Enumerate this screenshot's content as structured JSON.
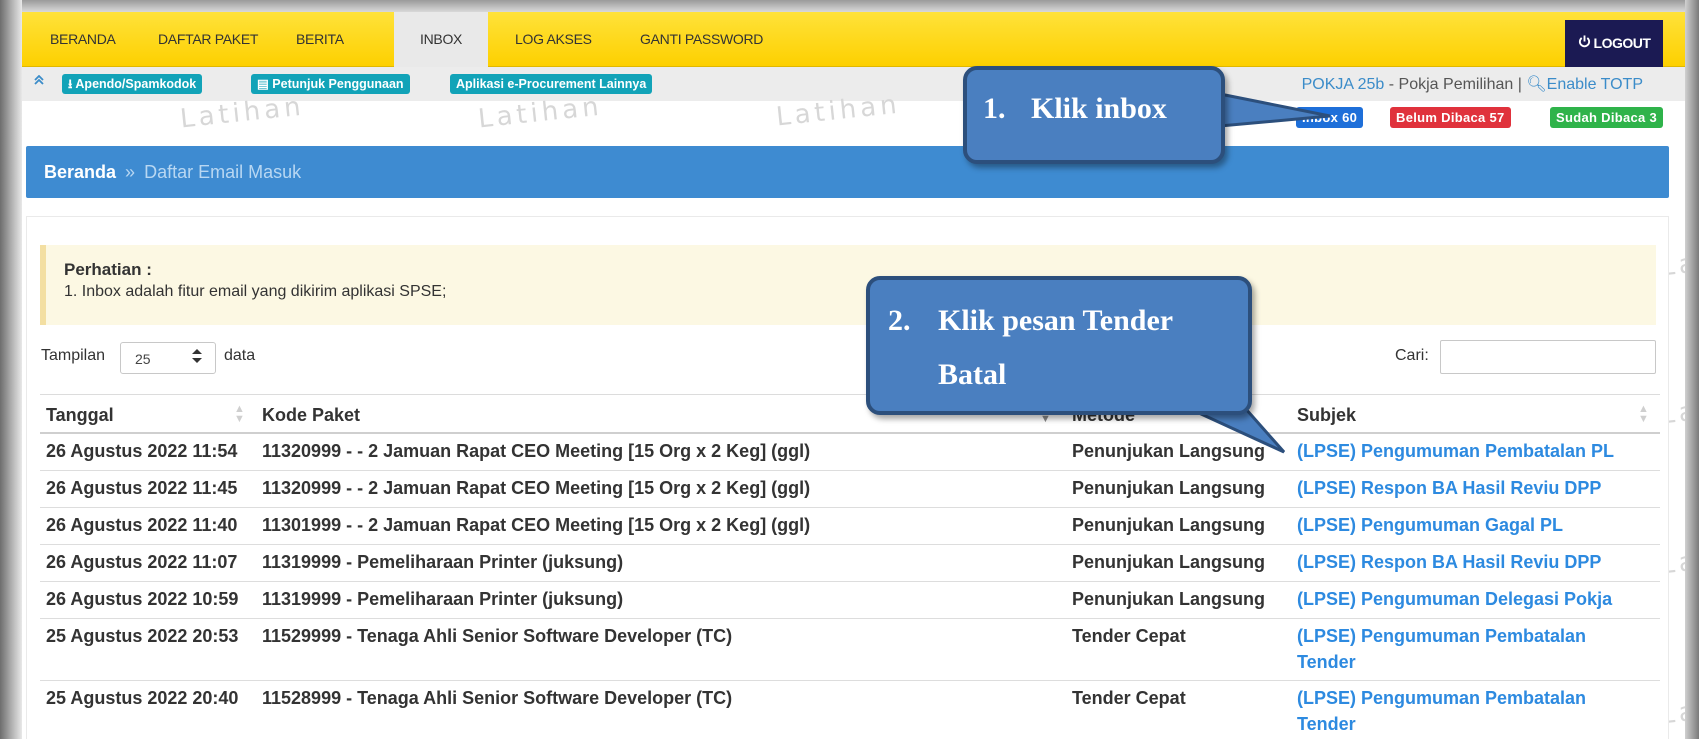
{
  "nav": {
    "items": [
      "BERANDA",
      "DAFTAR PAKET",
      "BERITA",
      "INBOX",
      "LOG AKSES",
      "GANTI PASSWORD"
    ],
    "logout_label": "LOGOUT",
    "active_item": "INBOX"
  },
  "subbar": {
    "links": [
      "Apendo/Spamkodok",
      "Petunjuk Penggunaan",
      "Aplikasi e-Procurement Lainnya"
    ],
    "user_name": "POKJA 25b",
    "user_role": " - Pokja Pemilihan | ",
    "enable_totp": "Enable TOTP"
  },
  "badges": {
    "inbox": "Inbox 60",
    "unread": "Belum Dibaca 57",
    "read": "Sudah Dibaca 3"
  },
  "watermark": "Latihan",
  "breadcrumb": {
    "home": "Beranda",
    "separator": "»",
    "current": "Daftar Email Masuk"
  },
  "notice": {
    "title": "Perhatian :",
    "text": "1. Inbox adalah fitur email yang dikirim aplikasi SPSE;"
  },
  "controls": {
    "show_label": "Tampilan",
    "page_length": "25",
    "data_label": "data",
    "search_label": "Cari:",
    "search_value": ""
  },
  "table": {
    "headers": [
      "Tanggal",
      "Kode Paket",
      "Metode",
      "Subjek"
    ],
    "rows": [
      {
        "date": "26 Agustus 2022 11:54",
        "kode": "11320999 - - 2 Jamuan Rapat CEO Meeting [15 Org x 2 Keg] (ggl)",
        "metode": "Penunjukan Langsung",
        "subjek": "(LPSE) Pengumuman Pembatalan PL"
      },
      {
        "date": "26 Agustus 2022 11:45",
        "kode": "11320999 - - 2 Jamuan Rapat CEO Meeting [15 Org x 2 Keg] (ggl)",
        "metode": "Penunjukan Langsung",
        "subjek": "(LPSE) Respon BA Hasil Reviu DPP"
      },
      {
        "date": "26 Agustus 2022 11:40",
        "kode": "11301999 - - 2 Jamuan Rapat CEO Meeting [15 Org x 2 Keg] (ggl)",
        "metode": "Penunjukan Langsung",
        "subjek": "(LPSE) Pengumuman Gagal PL"
      },
      {
        "date": "26 Agustus 2022 11:07",
        "kode": "11319999 - Pemeliharaan Printer (juksung)",
        "metode": "Penunjukan Langsung",
        "subjek": "(LPSE) Respon BA Hasil Reviu DPP"
      },
      {
        "date": "26 Agustus 2022 10:59",
        "kode": "11319999 - Pemeliharaan Printer (juksung)",
        "metode": "Penunjukan Langsung",
        "subjek": "(LPSE) Pengumuman Delegasi Pokja"
      },
      {
        "date": "25 Agustus 2022 20:53",
        "kode": "11529999 - Tenaga Ahli Senior Software Developer (TC)",
        "metode": "Tender Cepat",
        "subjek": "(LPSE) Pengumuman Pembatalan Tender"
      },
      {
        "date": "25 Agustus 2022 20:40",
        "kode": "11528999 - Tenaga Ahli Senior Software Developer (TC)",
        "metode": "Tender Cepat",
        "subjek": "(LPSE) Pengumuman Pembatalan Tender"
      }
    ]
  },
  "callouts": {
    "step1": {
      "num": "1.",
      "text": "Klik inbox"
    },
    "step2": {
      "num": "2.",
      "line1": "Klik pesan Tender",
      "line2": "Batal"
    }
  },
  "colors": {
    "nav_yellow": "#fdd000",
    "logout_bg": "#1b1a53",
    "breadcrumb_bg": "#3e8bd1",
    "badge_inbox": "#1e6fd9",
    "badge_unread": "#e0323c",
    "badge_read": "#2fb34a",
    "link_blue": "#2d8ae0",
    "callout_fill": "#4a7fc0"
  },
  "icons": {
    "logout": "power-icon",
    "apendo": "download-icon",
    "petunjuk": "book-icon",
    "totp": "key-icon",
    "collapse": "chevron-up-double-icon"
  }
}
